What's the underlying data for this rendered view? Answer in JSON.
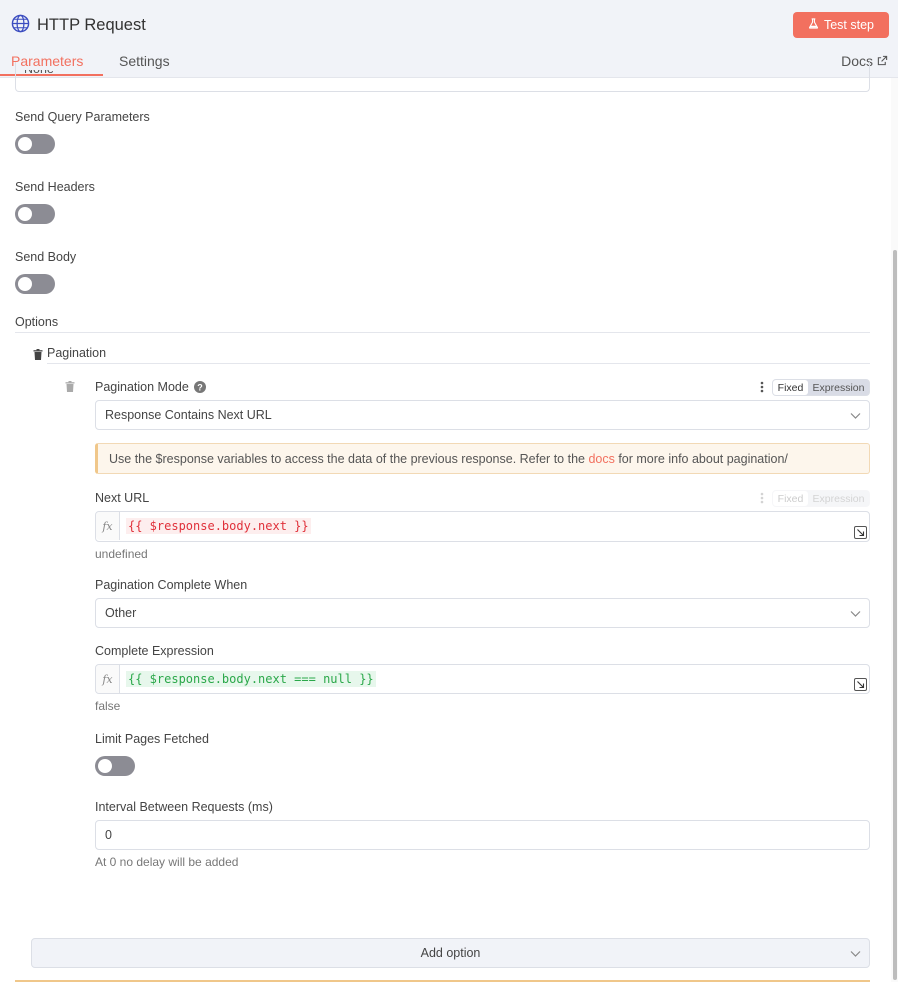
{
  "header": {
    "title": "HTTP Request",
    "test_button": "Test step",
    "tabs": [
      "Parameters",
      "Settings"
    ],
    "docs_label": "Docs"
  },
  "form": {
    "top_select_value": "None",
    "send_query_label": "Send Query Parameters",
    "send_headers_label": "Send Headers",
    "send_body_label": "Send Body",
    "options_label": "Options",
    "pagination_label": "Pagination",
    "pagination_mode_label": "Pagination Mode",
    "fixed_label": "Fixed",
    "expression_label": "Expression",
    "pagination_mode_value": "Response Contains Next URL",
    "notice_before": "Use the $response variables to access the data of the previous response. Refer to the ",
    "notice_link": "docs",
    "notice_after": " for more info about pagination/",
    "next_url_label": "Next URL",
    "next_url_expr": "{{ $response.body.next }}",
    "next_url_result": "undefined",
    "complete_when_label": "Pagination Complete When",
    "complete_when_value": "Other",
    "complete_expr_label": "Complete Expression",
    "complete_expr": "{{ $response.body.next === null }}",
    "complete_expr_result": "false",
    "limit_pages_label": "Limit Pages Fetched",
    "interval_label": "Interval Between Requests (ms)",
    "interval_value": "0",
    "interval_hint": "At 0 no delay will be added",
    "add_option_label": "Add option"
  },
  "colors": {
    "accent": "#f2705f",
    "toggle_off": "#8c8c94",
    "header_bg": "#f1f3f8"
  }
}
